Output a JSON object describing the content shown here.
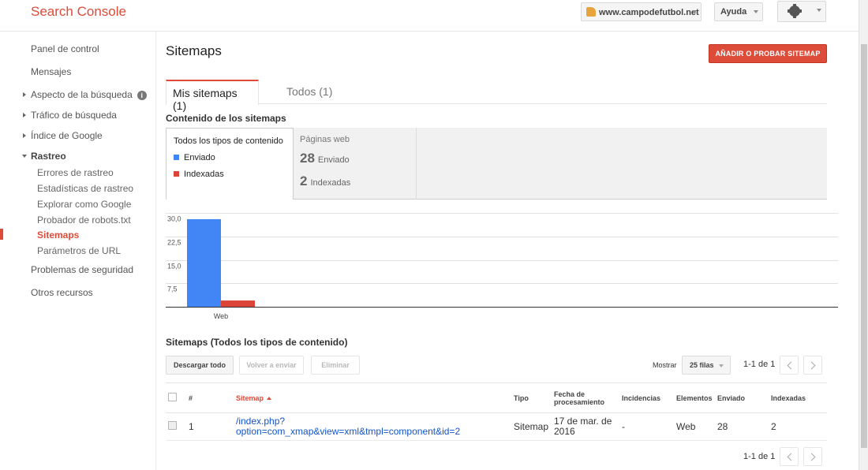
{
  "app": {
    "title": "Search Console"
  },
  "header": {
    "site": "www.campodefutbol.net",
    "help_label": "Ayuda"
  },
  "sidebar": {
    "items": [
      {
        "label": "Panel de control"
      },
      {
        "label": "Mensajes"
      },
      {
        "label": "Aspecto de la búsqueda"
      },
      {
        "label": "Tráfico de búsqueda"
      },
      {
        "label": "Índice de Google"
      },
      {
        "label": "Rastreo"
      },
      {
        "label": "Problemas de seguridad"
      },
      {
        "label": "Otros recursos"
      }
    ],
    "rastreo_sub": [
      {
        "label": "Errores de rastreo"
      },
      {
        "label": "Estadísticas de rastreo"
      },
      {
        "label": "Explorar como Google"
      },
      {
        "label": "Probador de robots.txt"
      },
      {
        "label": "Sitemaps"
      },
      {
        "label": "Parámetros de URL"
      }
    ]
  },
  "main": {
    "title": "Sitemaps",
    "add_button": "AÑADIR O PROBAR SITEMAP",
    "tabs": [
      {
        "label": "Mis sitemaps (1)"
      },
      {
        "label": "Todos (1)"
      }
    ],
    "content_title": "Contenido de los sitemaps",
    "filter": {
      "all_types": "Todos los tipos de contenido",
      "legend": [
        {
          "label": "Enviado",
          "color": "#4285f4"
        },
        {
          "label": "Indexadas",
          "color": "#db4437"
        }
      ]
    },
    "stats": {
      "header": "Páginas web",
      "sent_value": "28",
      "sent_label": "Enviado",
      "indexed_value": "2",
      "indexed_label": "Indexadas"
    },
    "table_title": "Sitemaps (Todos los tipos de contenido)",
    "toolbar": {
      "download": "Descargar todo",
      "resubmit": "Volver a enviar",
      "delete": "Eliminar",
      "show_label": "Mostrar",
      "rows_value": "25 filas",
      "pager": "1-1 de 1"
    },
    "table": {
      "headers": {
        "num": "#",
        "sitemap": "Sitemap",
        "type": "Tipo",
        "date": "Fecha de procesamiento",
        "issues": "Incidencias",
        "elements": "Elementos",
        "sent": "Enviado",
        "indexed": "Indexadas"
      },
      "rows": [
        {
          "num": "1",
          "sitemap": "/index.php?option=com_xmap&view=xml&tmpl=component&id=2",
          "type": "Sitemap",
          "date": "17 de mar. de 2016",
          "issues": "-",
          "elements": "Web",
          "sent": "28",
          "indexed": "2"
        }
      ]
    }
  },
  "chart_data": {
    "type": "bar",
    "categories": [
      "Web"
    ],
    "series": [
      {
        "name": "Enviado",
        "values": [
          28
        ],
        "color": "#4285f4"
      },
      {
        "name": "Indexadas",
        "values": [
          2
        ],
        "color": "#db4437"
      }
    ],
    "yticks": [
      "7,5",
      "15,0",
      "22,5",
      "30,0"
    ],
    "ylim": [
      0,
      30
    ],
    "grid": true
  }
}
